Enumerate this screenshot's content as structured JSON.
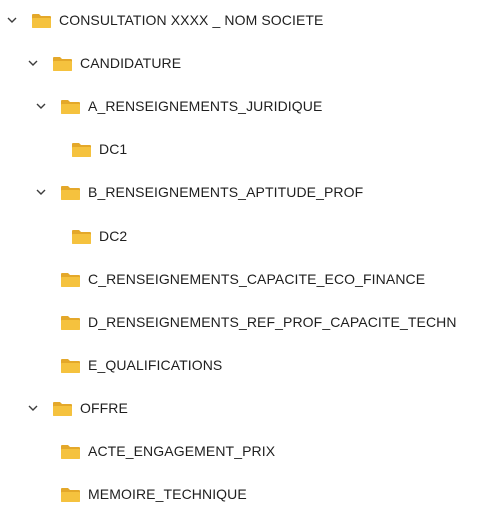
{
  "tree": {
    "nodes": [
      {
        "label": "CONSULTATION XXXX _ NOM SOCIETE",
        "level": 0,
        "expanded": true,
        "icon": "folder-icon"
      },
      {
        "label": "CANDIDATURE",
        "level": 1,
        "expanded": true,
        "icon": "folder-icon"
      },
      {
        "label": "A_RENSEIGNEMENTS_JURIDIQUE",
        "level": 2,
        "expanded": true,
        "icon": "folder-icon"
      },
      {
        "label": "DC1",
        "level": 3,
        "expanded": null,
        "icon": "folder-icon"
      },
      {
        "label": "B_RENSEIGNEMENTS_APTITUDE_PROF",
        "level": 2,
        "expanded": true,
        "icon": "folder-icon"
      },
      {
        "label": "DC2",
        "level": 3,
        "expanded": null,
        "icon": "folder-icon"
      },
      {
        "label": "C_RENSEIGNEMENTS_CAPACITE_ECO_FINANCE",
        "level": 2,
        "expanded": null,
        "icon": "folder-icon"
      },
      {
        "label": "D_RENSEIGNEMENTS_REF_PROF_CAPACITE_TECHN",
        "level": 2,
        "expanded": null,
        "icon": "folder-icon"
      },
      {
        "label": "E_QUALIFICATIONS",
        "level": 2,
        "expanded": null,
        "icon": "folder-icon"
      },
      {
        "label": "OFFRE",
        "level": 1,
        "expanded": true,
        "icon": "folder-icon"
      },
      {
        "label": "ACTE_ENGAGEMENT_PRIX",
        "level": 2,
        "expanded": null,
        "icon": "folder-icon"
      },
      {
        "label": "MEMOIRE_TECHNIQUE",
        "level": 2,
        "expanded": null,
        "icon": "folder-icon"
      }
    ]
  },
  "colors": {
    "folder_front": "#f5c23e",
    "folder_back": "#e4a82a",
    "chevron": "#3c3c3c",
    "text": "#1e1e1e"
  }
}
